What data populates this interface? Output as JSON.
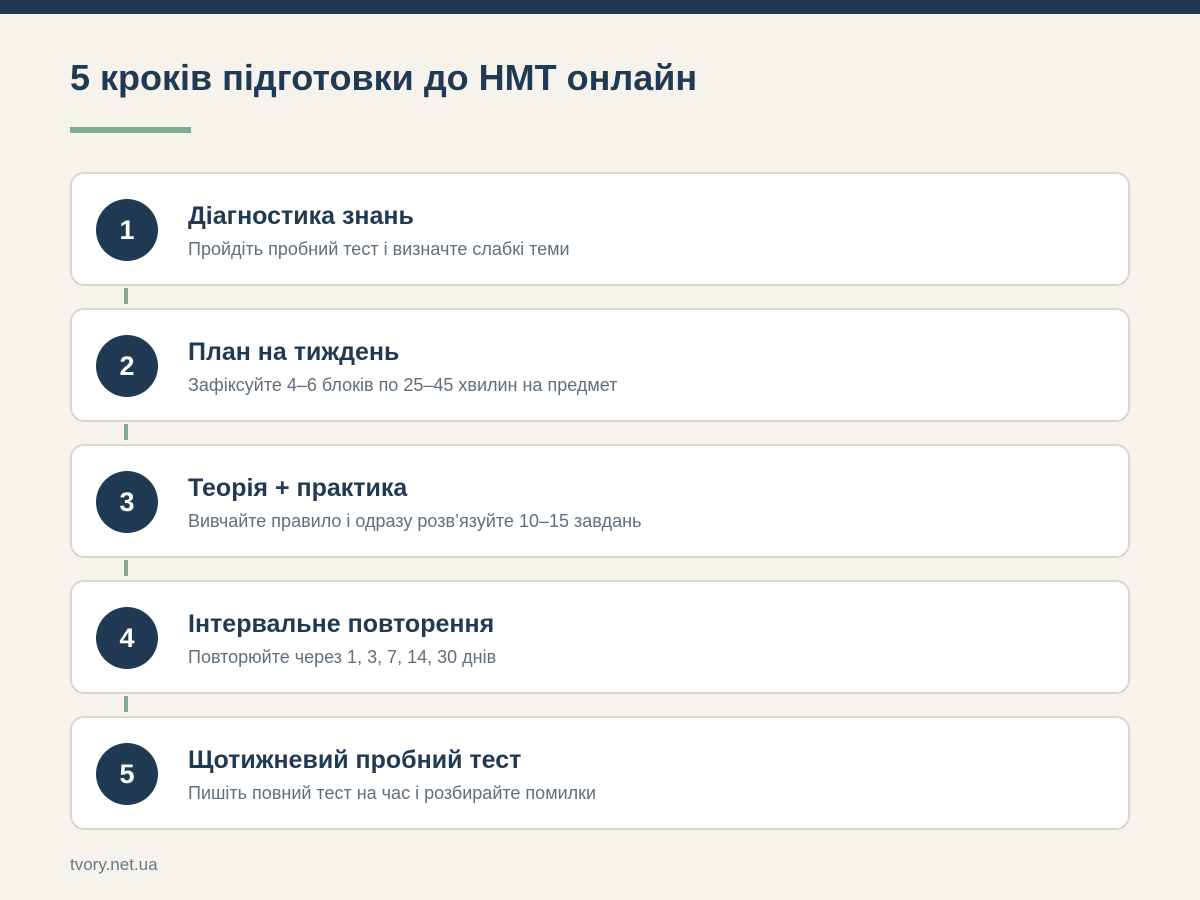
{
  "title": "5 кроків підготовки до НМТ онлайн",
  "colors": {
    "accent": "#1f3a52",
    "underline": "#83aa95",
    "background": "#f6f3ec",
    "card_border": "#ddd5c7"
  },
  "steps": [
    {
      "number": "1",
      "title": "Діагностика знань",
      "description": "Пройдіть пробний тест і визначте слабкі теми"
    },
    {
      "number": "2",
      "title": "План на тиждень",
      "description": "Зафіксуйте 4–6 блоків по 25–45 хвилин на предмет"
    },
    {
      "number": "3",
      "title": "Теорія + практика",
      "description": "Вивчайте правило і одразу розв’язуйте 10–15 завдань"
    },
    {
      "number": "4",
      "title": "Інтервальне повторення",
      "description": "Повторюйте через 1, 3, 7, 14, 30 днів"
    },
    {
      "number": "5",
      "title": "Щотижневий пробний тест",
      "description": "Пишіть повний тест на час і розбирайте помилки"
    }
  ],
  "footer": "tvory.net.ua"
}
